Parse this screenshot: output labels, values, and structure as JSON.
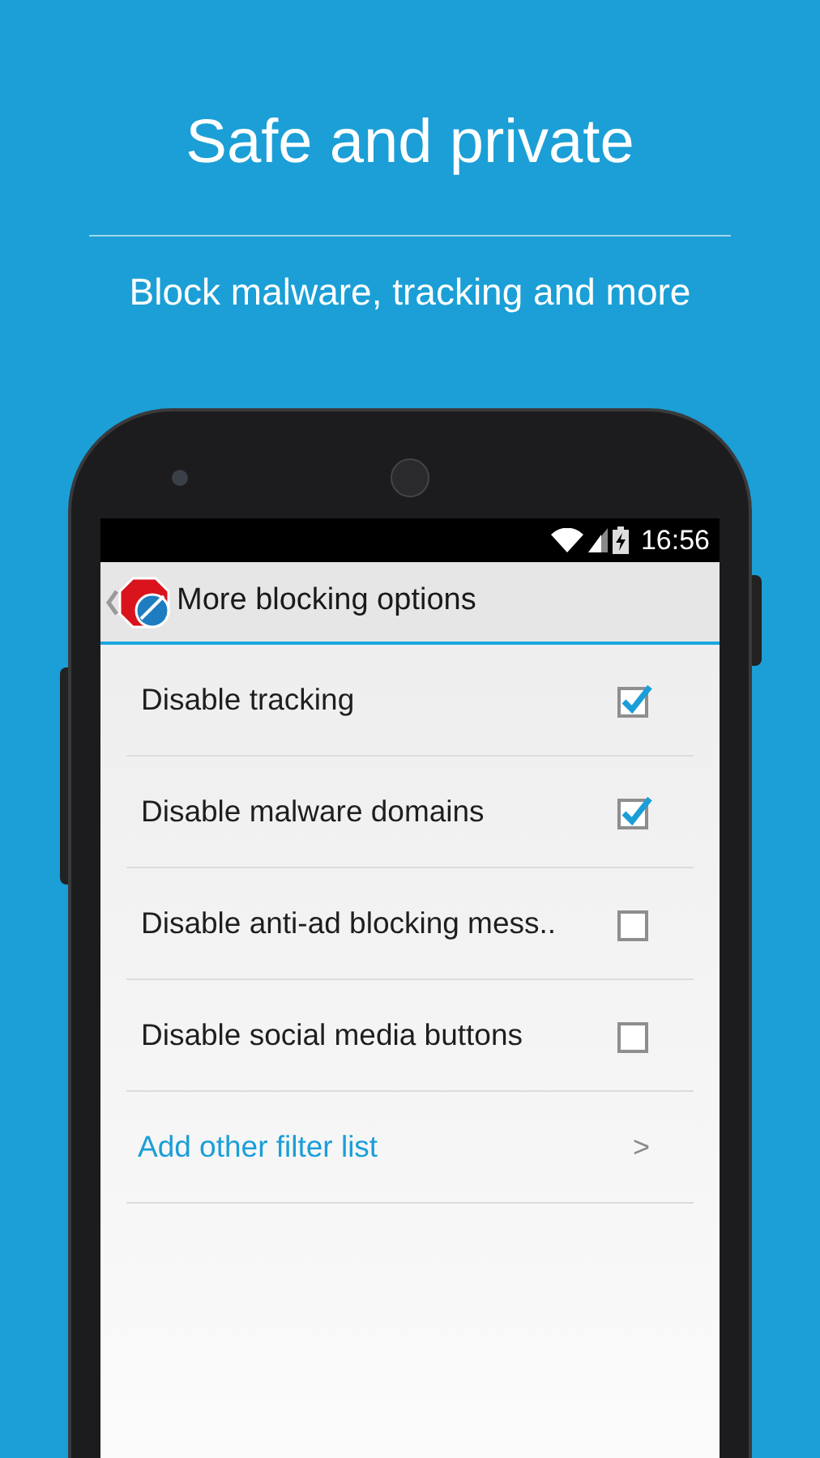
{
  "headline": "Safe and private",
  "subheadline": "Block malware, tracking and more",
  "status_bar": {
    "time": "16:56"
  },
  "app_bar": {
    "title": "More blocking options"
  },
  "settings": [
    {
      "kind": "checkbox",
      "label": "Disable tracking",
      "checked": true
    },
    {
      "kind": "checkbox",
      "label": "Disable malware domains",
      "checked": true
    },
    {
      "kind": "checkbox",
      "label": "Disable anti-ad blocking mess..",
      "checked": false
    },
    {
      "kind": "checkbox",
      "label": "Disable social media buttons",
      "checked": false
    },
    {
      "kind": "link",
      "label": "Add other filter list",
      "chevron": ">"
    }
  ]
}
